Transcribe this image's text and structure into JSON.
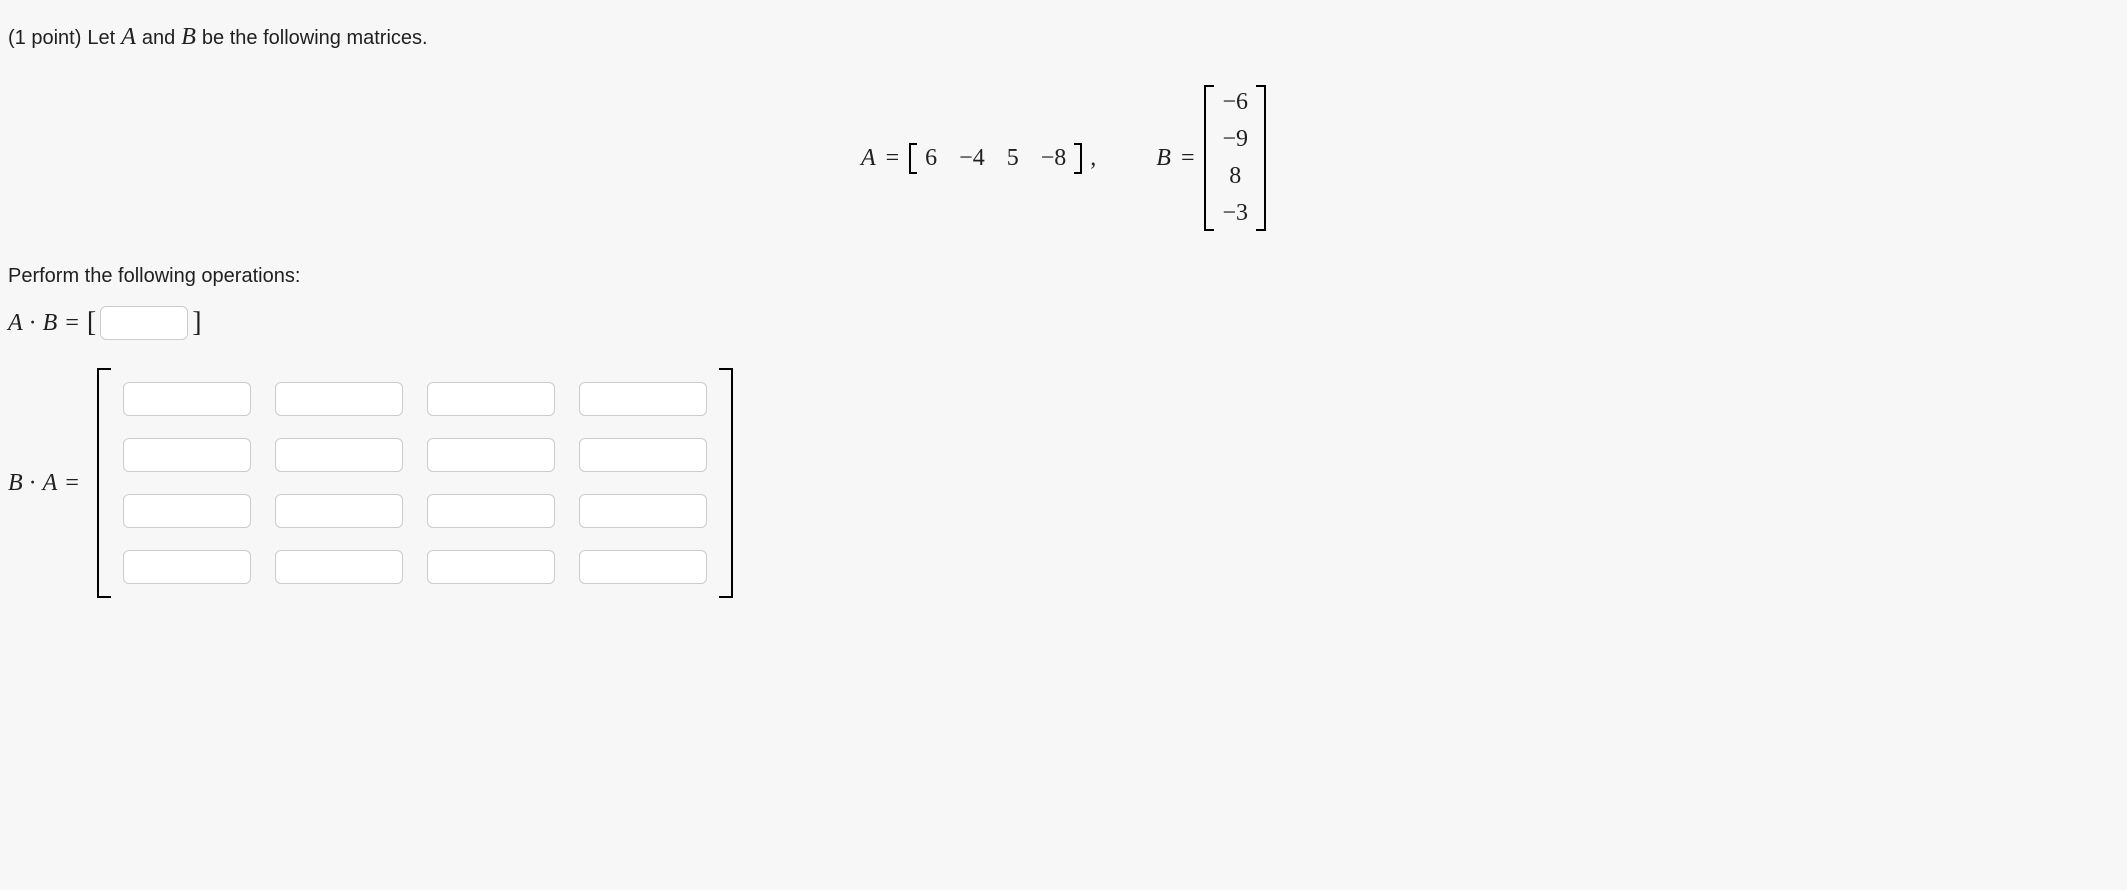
{
  "points_label": "(1 point)",
  "intro_pre": "Let",
  "intro_sym_A": "A",
  "intro_mid": "and",
  "intro_sym_B": "B",
  "intro_post": "be the following matrices.",
  "equation": {
    "A_label": "A",
    "eq_sign": "=",
    "A_row": [
      "6",
      "−4",
      "5",
      "−8"
    ],
    "comma": ",",
    "B_label": "B",
    "B_col": [
      "−6",
      "−9",
      "8",
      "−3"
    ]
  },
  "perform_label": "Perform the following operations:",
  "ab": {
    "lhs_A": "A",
    "dot": "·",
    "lhs_B": "B",
    "eq": "=",
    "lbr": "[",
    "rbr": "]"
  },
  "ba": {
    "lhs_B": "B",
    "dot": "·",
    "lhs_A": "A",
    "eq": "="
  }
}
